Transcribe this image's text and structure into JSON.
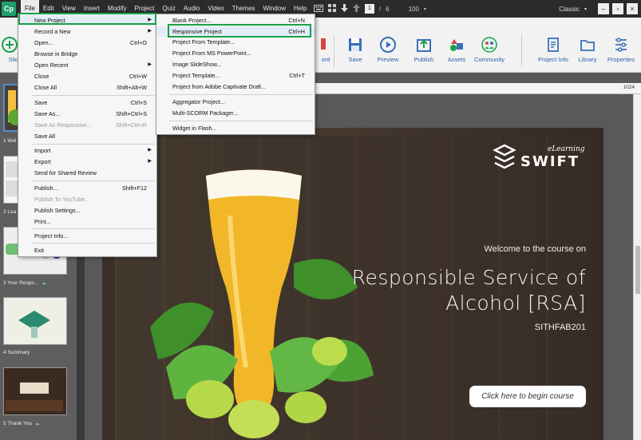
{
  "app": {
    "logo": "Cp",
    "menus": [
      "File",
      "Edit",
      "View",
      "Insert",
      "Modify",
      "Project",
      "Quiz",
      "Audio",
      "Video",
      "Themes",
      "Window",
      "Help"
    ],
    "active_menu": "File",
    "page_current": "1",
    "page_sep": "/",
    "page_total": "6",
    "zoom": "100",
    "workspace": "Classic",
    "accent": "#1aa14a"
  },
  "toolbar": {
    "slides_label": "Slide",
    "record_label": "ord",
    "save_label": "Save",
    "preview_label": "Preview",
    "publish_label": "Publish",
    "assets_label": "Assets",
    "community_label": "Community",
    "project_info_label": "Project Info",
    "library_label": "Library",
    "properties_label": "Properties"
  },
  "filmstrip": {
    "slides": [
      {
        "caption": "1 Wel"
      },
      {
        "caption": "2 Lea"
      },
      {
        "caption": "3 Your Respo..."
      },
      {
        "caption": "4 Summary"
      },
      {
        "caption": "5 Thank You"
      }
    ]
  },
  "ruler": {
    "value": "1024"
  },
  "slide": {
    "brand_small": "eLearning",
    "brand_large": "SWIFT",
    "welcome": "Welcome to the course on",
    "title_line1": "Responsible Service of",
    "title_line2": "Alcohol [RSA]",
    "code": "SITHFAB201",
    "button": "Click here to begin course"
  },
  "file_menu": {
    "items": [
      {
        "label": "New Project",
        "shortcut": "",
        "submenu": true
      },
      {
        "label": "Record a New",
        "shortcut": "",
        "submenu": true
      },
      {
        "label": "Open...",
        "shortcut": "Ctrl+O"
      },
      {
        "label": "Browse in Bridge",
        "shortcut": ""
      },
      {
        "label": "Open Recent",
        "shortcut": "",
        "submenu": true
      },
      {
        "label": "Close",
        "shortcut": "Ctrl+W"
      },
      {
        "label": "Close All",
        "shortcut": "Shift+Alt+W"
      },
      {
        "label": "Save",
        "shortcut": "Ctrl+S"
      },
      {
        "label": "Save As...",
        "shortcut": "Shift+Ctrl+S"
      },
      {
        "label": "Save As Responsive...",
        "shortcut": "Shift+Ctrl+R",
        "disabled": true
      },
      {
        "label": "Save All",
        "shortcut": ""
      },
      {
        "label": "Import",
        "shortcut": "",
        "submenu": true
      },
      {
        "label": "Export",
        "shortcut": "",
        "submenu": true
      },
      {
        "label": "Send for Shared Review",
        "shortcut": ""
      },
      {
        "label": "Publish...",
        "shortcut": "Shift+F12"
      },
      {
        "label": "Publish To YouTube...",
        "shortcut": "",
        "disabled": true
      },
      {
        "label": "Publish Settings...",
        "shortcut": ""
      },
      {
        "label": "Print...",
        "shortcut": ""
      },
      {
        "label": "Project Info...",
        "shortcut": ""
      },
      {
        "label": "Exit",
        "shortcut": ""
      }
    ]
  },
  "new_project_menu": {
    "items": [
      {
        "label": "Blank Project...",
        "shortcut": "Ctrl+N"
      },
      {
        "label": "Responsive Project",
        "shortcut": "Ctrl+H"
      },
      {
        "label": "Project From Template...",
        "shortcut": ""
      },
      {
        "label": "Project From MS PowerPoint...",
        "shortcut": ""
      },
      {
        "label": "Image SlideShow...",
        "shortcut": ""
      },
      {
        "label": "Project Template...",
        "shortcut": "Ctrl+T"
      },
      {
        "label": "Project from Adobe Captivate Draft...",
        "shortcut": ""
      },
      {
        "label": "Aggregator Project...",
        "shortcut": ""
      },
      {
        "label": "Multi-SCORM Packager...",
        "shortcut": ""
      },
      {
        "label": "Widget in Flash...",
        "shortcut": ""
      }
    ]
  }
}
